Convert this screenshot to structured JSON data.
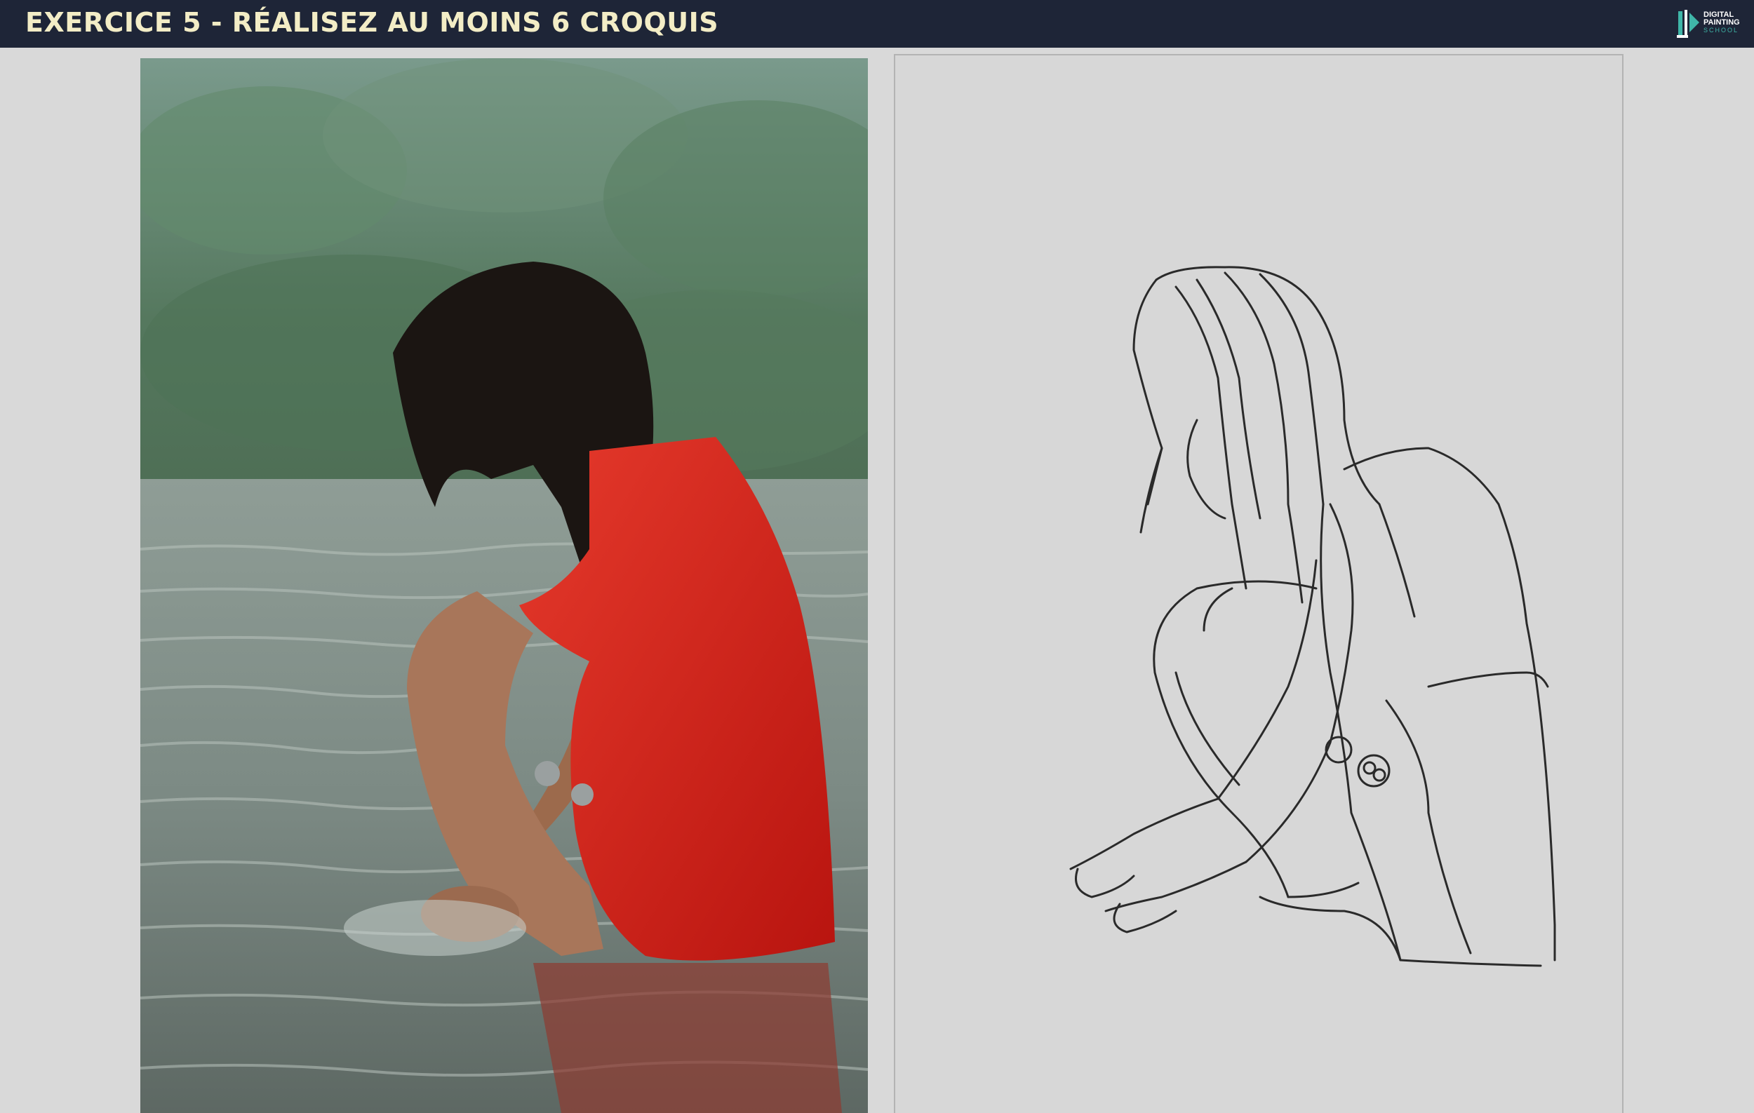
{
  "header": {
    "title": "EXERCICE 5 - RÉALISEZ AU MOINS 6 CROQUIS",
    "logo": {
      "line1": "DIGITAL",
      "line2": "PAINTING",
      "line3": "SCHOOL",
      "icon": "paintbrush-logo-icon"
    }
  },
  "colors": {
    "header_bg": "#1e2537",
    "title_text": "#f3edc6",
    "page_bg": "#d9d9d9",
    "accent_teal": "#3fb6a8",
    "dress_red": "#d8231c"
  },
  "content": {
    "reference_photo": "woman-in-red-dress-crouching-in-water",
    "sketch": "line-drawing-of-crouching-woman"
  }
}
